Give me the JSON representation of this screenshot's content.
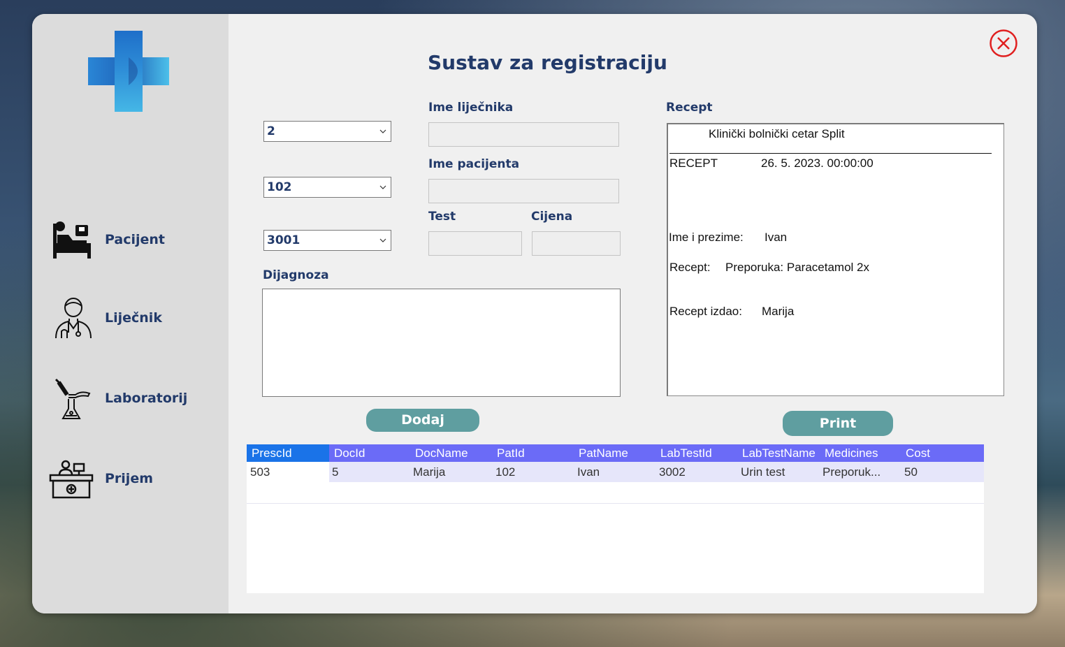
{
  "title": "Sustav za registraciju",
  "sidebar": {
    "items": [
      {
        "label": "Pacijent",
        "icon": "patient-bed-icon"
      },
      {
        "label": "Liječnik",
        "icon": "doctor-icon"
      },
      {
        "label": "Laboratorij",
        "icon": "laboratory-icon"
      },
      {
        "label": "Prijem",
        "icon": "reception-desk-icon"
      }
    ]
  },
  "form": {
    "select_doctor_id": "2",
    "select_patient_id": "102",
    "select_test_id": "3001",
    "doctor_name_label": "Ime liječnika",
    "doctor_name_value": "",
    "patient_name_label": "Ime pacijenta",
    "patient_name_value": "",
    "test_label": "Test",
    "test_value": "",
    "cost_label": "Cijena",
    "cost_value": "",
    "diagnosis_label": "Dijagnoza",
    "diagnosis_value": "",
    "add_button": "Dodaj"
  },
  "recept": {
    "label": "Recept",
    "hospital": "Klinički bolnički cetar Split",
    "heading": "RECEPT",
    "date": "26. 5. 2023. 00:00:00",
    "name_label": "Ime i prezime:",
    "name_value": "Ivan",
    "recept_label": "Recept:",
    "recept_value": "Preporuka: Paracetamol 2x",
    "issued_label": "Recept izdao:",
    "issued_value": "Marija",
    "print_button": "Print"
  },
  "table": {
    "columns": [
      "PrescId",
      "DocId",
      "DocName",
      "PatId",
      "PatName",
      "LabTestId",
      "LabTestName",
      "Medicines",
      "Cost"
    ],
    "rows": [
      [
        "503",
        "5",
        "Marija",
        "102",
        "Ivan",
        "3002",
        "Urin test",
        "Preporuk...",
        "50"
      ]
    ]
  },
  "colors": {
    "accent_button": "#5f9ea0",
    "title_text": "#223a6a",
    "grid_header": "#6b6bf7",
    "grid_row": "#e6e6fa",
    "close_icon": "#e02020"
  }
}
